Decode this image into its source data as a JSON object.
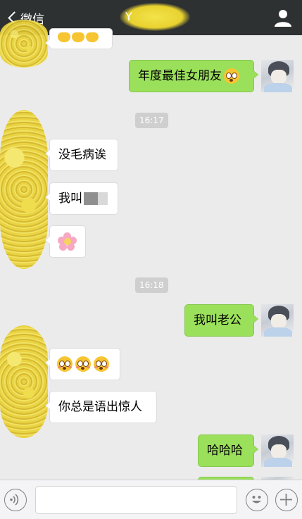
{
  "header": {
    "back_label": "微信",
    "title": "Y"
  },
  "messages": [
    {
      "side": "left",
      "type": "emoji",
      "content": "partial-hands"
    },
    {
      "side": "right",
      "type": "text",
      "text": "年度最佳女朋友"
    },
    {
      "type": "time",
      "text": "16:17"
    },
    {
      "side": "left",
      "type": "text",
      "text": "没毛病诶"
    },
    {
      "side": "left",
      "type": "text",
      "text": "我叫"
    },
    {
      "side": "left",
      "type": "emoji",
      "content": "cherry-blossom"
    },
    {
      "type": "time",
      "text": "16:18"
    },
    {
      "side": "right",
      "type": "text",
      "text": "我叫老公"
    },
    {
      "side": "left",
      "type": "emoji",
      "content": "flushed-face x3"
    },
    {
      "side": "left",
      "type": "text",
      "text": "你总是语出惊人"
    },
    {
      "side": "right",
      "type": "text",
      "text": "哈哈哈"
    }
  ],
  "colors": {
    "header_bg": "#2e3132",
    "chat_bg": "#ebebeb",
    "outgoing_bubble": "#9be05b",
    "incoming_bubble": "#ffffff"
  },
  "icons": [
    "back-chevron-icon",
    "person-icon",
    "voice-icon",
    "emoji-icon",
    "plus-icon"
  ]
}
